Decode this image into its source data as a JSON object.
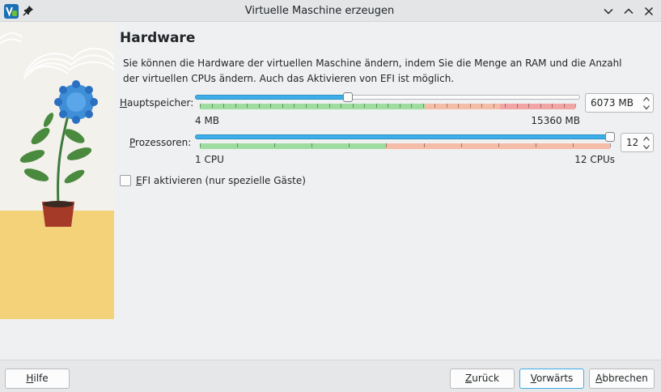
{
  "window": {
    "title": "Virtuelle Maschine erzeugen",
    "icons": {
      "app": "virtualbox-icon",
      "pin": "pin-icon",
      "minimize": "chevron-down-icon",
      "maximize": "chevron-up-icon",
      "close": "close-icon"
    }
  },
  "page": {
    "title": "Hardware",
    "description_line1": "Sie können die Hardware der virtuellen Maschine ändern, indem Sie die Menge an RAM und die Anzahl",
    "description_line2": "der virtuellen CPUs ändern. Auch das Aktivieren von EFI ist möglich."
  },
  "memory": {
    "label_mnemonic": "H",
    "label_rest": "auptspeicher:",
    "min_label": "4 MB",
    "max_label": "15360 MB",
    "value": "6073 MB",
    "min": 4,
    "max": 15360,
    "current": 6073,
    "green_until": 9216,
    "orange_until": 12288
  },
  "cpu": {
    "label_mnemonic": "P",
    "label_rest": "rozessoren:",
    "min_label": "1 CPU",
    "max_label": "12 CPUs",
    "value": "12",
    "min": 1,
    "max": 12,
    "current": 12,
    "green_until": 6
  },
  "efi": {
    "label_mnemonic": "E",
    "label_rest": "FI aktivieren (nur spezielle Gäste)",
    "checked": false
  },
  "buttons": {
    "help_mnemonic": "H",
    "help_rest": "ilfe",
    "back_mnemonic": "Z",
    "back_rest": "urück",
    "next_mnemonic": "V",
    "next_rest": "orwärts",
    "cancel_mnemonic": "A",
    "cancel_rest": "bbrechen"
  },
  "colors": {
    "accent": "#3daee9",
    "safe": "#9fdc9f",
    "warn": "#f5bca7",
    "danger": "#f2a5a5"
  }
}
